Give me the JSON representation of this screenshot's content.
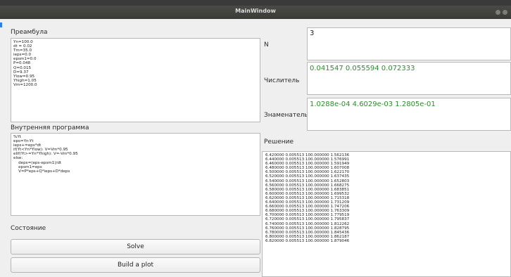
{
  "window": {
    "title": "MainWindow"
  },
  "labels": {
    "preamble": "Преамбула",
    "inner": "Внутренняя программа",
    "state": "Состояние",
    "n": "N",
    "numerator": "Числитель",
    "denominator": "Знаменатель",
    "solution": "Решение"
  },
  "preamble_text": "Yn=100.0\ndt = 0.02\nTm=35.0\nieps=0.0\nepsm1=0.0\nP=0.048\nQ=0.015\nD=9.37\nYlow=0.95\nYhigh=1.05\nVm=1200.0",
  "inner_text": "%Yt\neps=Yn-Yt\nieps+=eps*dt\nif(Yt<Yn*Ylow): V=Vm*0.95\nelif(Yt>=Yn*Yhigh): V=-Vm*0.95\nelse:\n    deps=(eps-epsm1)/dt\n    epsm1=eps\n    V=P*eps+Q*ieps+D*deps",
  "n_value": "3",
  "numerator_value": "0.041547  0.055594  0.072333",
  "denominator_value": "1.0288e-04  4.6029e-03  1.2805e-01",
  "solution_lines": [
    "6.420000 0.005513 100.000000 1.562136",
    "6.440000 0.005513 100.000000 1.576991",
    "6.460000 0.005513 100.000000 1.591949",
    "6.480000 0.005513 100.000000 1.607008",
    "6.500000 0.005513 100.000000 1.622170",
    "6.520000 0.005513 100.000000 1.637435",
    "6.540000 0.005513 100.000000 1.652803",
    "6.560000 0.005513 100.000000 1.668275",
    "6.580000 0.005513 100.000000 1.683851",
    "6.600000 0.005513 100.000000 1.699532",
    "6.620000 0.005513 100.000000 1.715318",
    "6.640000 0.005513 100.000000 1.731209",
    "6.660000 0.005513 100.000000 1.747206",
    "6.680000 0.005513 100.000000 1.763309",
    "6.700000 0.005513 100.000000 1.779519",
    "6.720000 0.005513 100.000000 1.795837",
    "6.740000 0.005513 100.000000 1.812262",
    "6.760000 0.005513 100.000000 1.828795",
    "6.780000 0.005513 100.000000 1.845436",
    "6.800000 0.005513 100.000000 1.862187",
    "6.820000 0.005513 100.000000 1.879046"
  ],
  "buttons": {
    "solve": "Solve",
    "plot": "Build a plot"
  }
}
